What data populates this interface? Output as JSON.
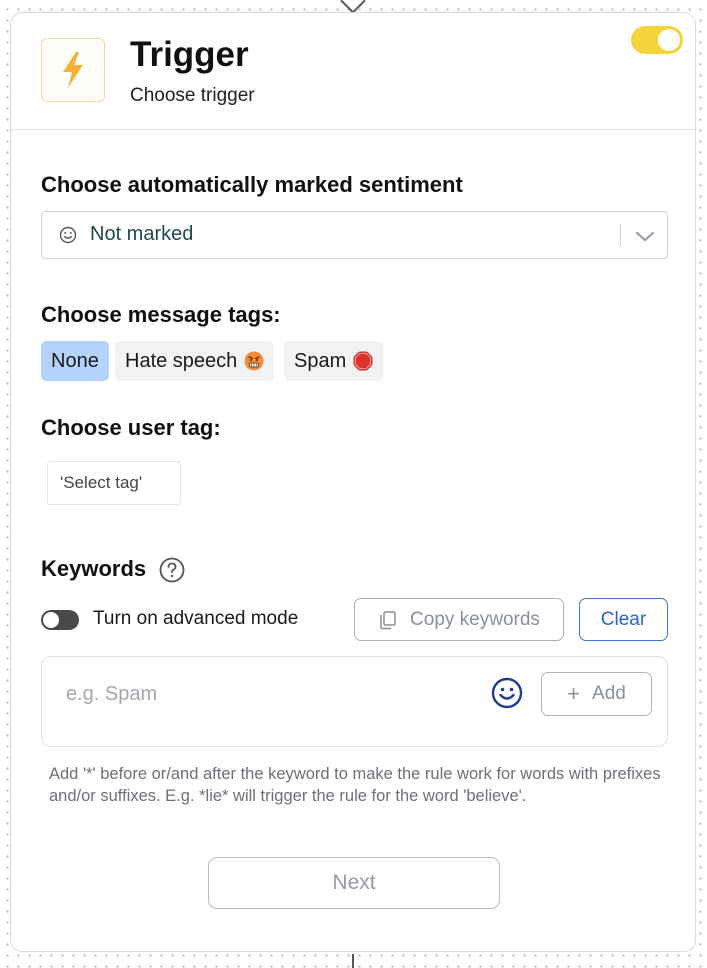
{
  "header": {
    "title": "Trigger",
    "subtitle": "Choose trigger",
    "icon": "lightning-bolt-icon",
    "enabled": true,
    "accent_color": "#f4d33b"
  },
  "sentiment": {
    "label": "Choose automatically marked sentiment",
    "selected": "Not marked",
    "icon": "smiley-icon"
  },
  "message_tags": {
    "label": "Choose message tags:",
    "options": [
      {
        "label": "None",
        "selected": true
      },
      {
        "label": "Hate speech",
        "emoji": "angry-face-emoji",
        "selected": false
      },
      {
        "label": "Spam",
        "emoji": "stop-sign-emoji",
        "selected": false
      }
    ],
    "selected_color": "#b4d3fb"
  },
  "user_tag": {
    "label": "Choose user tag:",
    "placeholder": "'Select tag'"
  },
  "keywords": {
    "label": "Keywords",
    "advanced_mode_label": "Turn on advanced mode",
    "advanced_mode_on": false,
    "copy_label": "Copy keywords",
    "clear_label": "Clear",
    "input_placeholder": "e.g. Spam",
    "add_label": "Add",
    "hint": "Add '*' before or/and after the keyword to make the rule work for words with prefixes and/or suffixes. E.g. *lie* will trigger the rule for the word 'believe'."
  },
  "footer": {
    "next_label": "Next"
  }
}
